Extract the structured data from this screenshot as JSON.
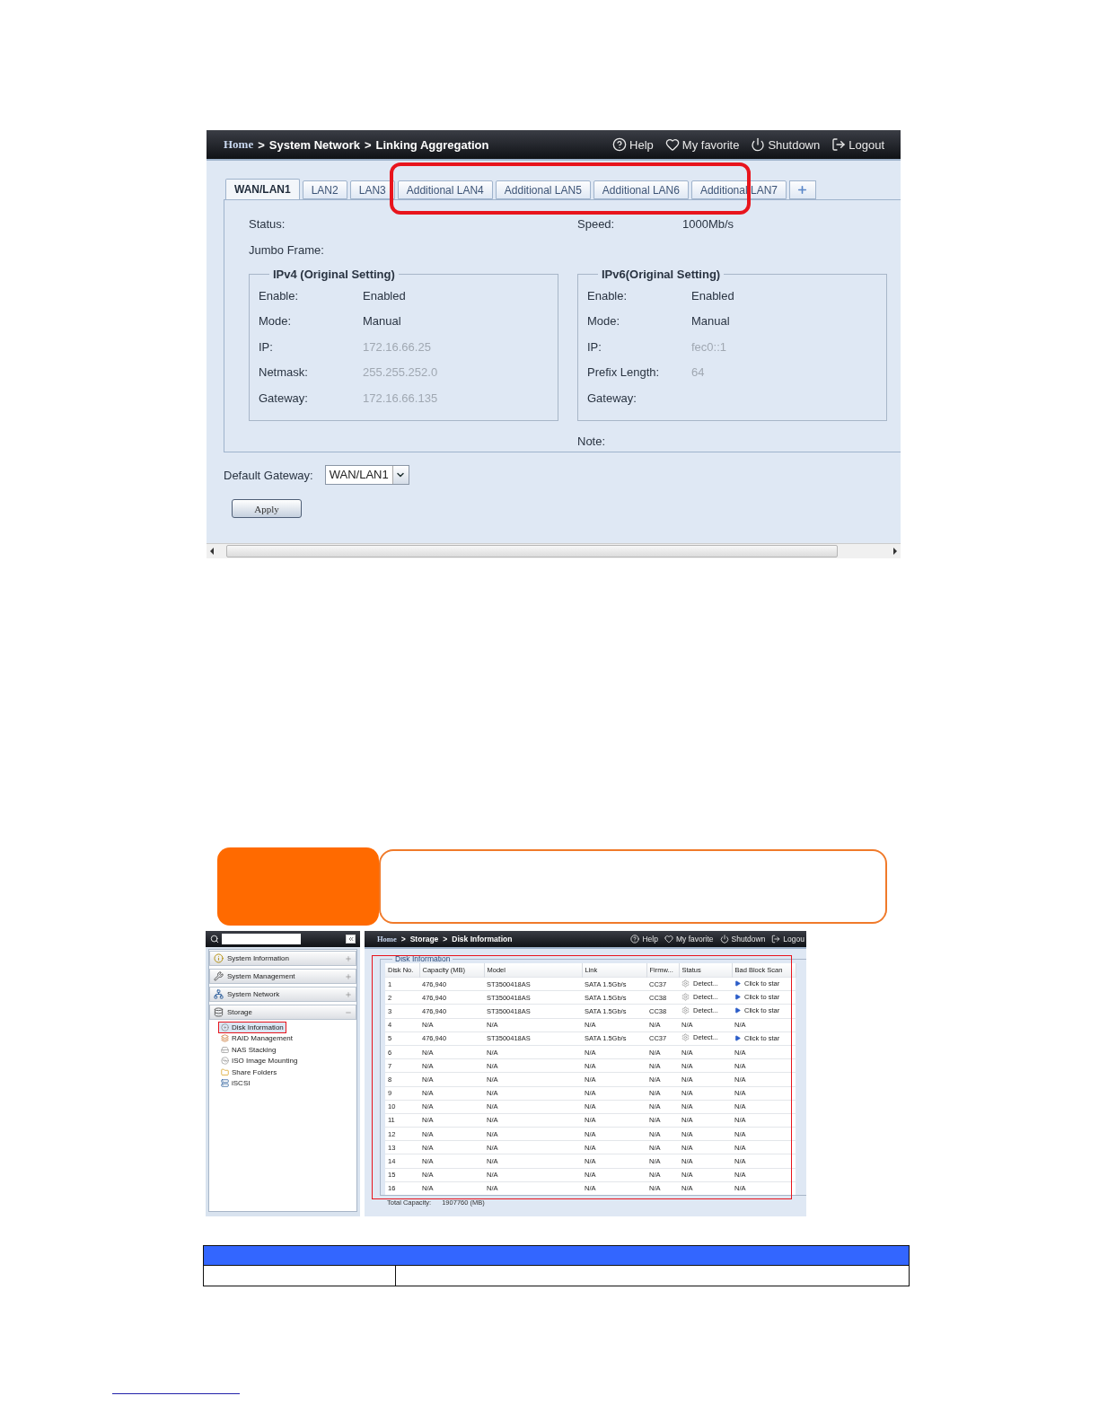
{
  "network_window": {
    "breadcrumb": [
      "Home",
      "System Network",
      "Linking Aggregation"
    ],
    "separator": ">",
    "toolbar": [
      {
        "label": "Help",
        "kind": "help"
      },
      {
        "label": "My favorite",
        "kind": "favorite"
      },
      {
        "label": "Shutdown",
        "kind": "shutdown"
      },
      {
        "label": "Logout",
        "kind": "logout"
      }
    ],
    "tabs": [
      {
        "label": "WAN/LAN1",
        "selected": true
      },
      {
        "label": "LAN2",
        "selected": false
      },
      {
        "label": "LAN3",
        "selected": false
      },
      {
        "label": "Additional LAN4",
        "selected": false
      },
      {
        "label": "Additional LAN5",
        "selected": false
      },
      {
        "label": "Additional LAN6",
        "selected": false
      },
      {
        "label": "Additional LAN7",
        "selected": false
      }
    ],
    "status_label": "Status:",
    "speed_label": "Speed:",
    "speed_value": "1000Mb/s",
    "jumbo_label": "Jumbo Frame:",
    "ipv4": {
      "title": "IPv4 (Original Setting)",
      "fields": [
        {
          "label": "Enable:",
          "value": "Enabled",
          "greyed": false
        },
        {
          "label": "Mode:",
          "value": "Manual",
          "greyed": false
        },
        {
          "label": "IP:",
          "value": "172.16.66.25",
          "greyed": true
        },
        {
          "label": "Netmask:",
          "value": "255.255.252.0",
          "greyed": true
        },
        {
          "label": "Gateway:",
          "value": "172.16.66.135",
          "greyed": true
        }
      ]
    },
    "ipv6": {
      "title": "IPv6(Original Setting)",
      "fields": [
        {
          "label": "Enable:",
          "value": "Enabled",
          "greyed": false
        },
        {
          "label": "Mode:",
          "value": "Manual",
          "greyed": false
        },
        {
          "label": "IP:",
          "value": "fec0::1",
          "greyed": true
        },
        {
          "label": "Prefix Length:",
          "value": "64",
          "greyed": true
        },
        {
          "label": "Gateway:"
        }
      ]
    },
    "note_label": "Note:",
    "default_gateway": {
      "label": "Default Gateway:",
      "value": "WAN/LAN1"
    },
    "apply": "Apply"
  },
  "disk_window": {
    "sidebar": [
      {
        "label": "System Information",
        "kind": "info",
        "expanded": false
      },
      {
        "label": "System Management",
        "kind": "tools",
        "expanded": false
      },
      {
        "label": "System Network",
        "kind": "network",
        "expanded": false
      },
      {
        "label": "Storage",
        "kind": "storage",
        "expanded": true,
        "children": [
          {
            "label": "Disk Information",
            "kind": "disk",
            "selected": true
          },
          {
            "label": "RAID Management",
            "kind": "raid",
            "selected": false
          },
          {
            "label": "NAS Stacking",
            "kind": "stack",
            "selected": false
          },
          {
            "label": "ISO Image Mounting",
            "kind": "iso",
            "selected": false
          },
          {
            "label": "Share Folders",
            "kind": "folder",
            "selected": false
          },
          {
            "label": "iSCSI",
            "kind": "iscsi",
            "selected": false
          }
        ]
      }
    ],
    "breadcrumb": [
      "Home",
      "Storage",
      "Disk Information"
    ],
    "separator": ">",
    "toolbar": [
      {
        "label": "Help",
        "kind": "help"
      },
      {
        "label": "My favorite",
        "kind": "favorite"
      },
      {
        "label": "Shutdown",
        "kind": "shutdown"
      },
      {
        "label": "Logou",
        "kind": "logout"
      }
    ],
    "section_title": "Disk Information",
    "columns": [
      "Disk No.",
      "Capacity (MB)",
      "Model",
      "Link",
      "Firmw...",
      "Status",
      "Bad Block Scan"
    ],
    "rows": [
      {
        "kind": "disk",
        "cells": [
          "1",
          "476,940",
          "ST3500418AS",
          "SATA 1.5Gb/s",
          "CC37",
          "Detect...",
          "Click to star"
        ]
      },
      {
        "kind": "disk",
        "cells": [
          "2",
          "476,940",
          "ST3500418AS",
          "SATA 1.5Gb/s",
          "CC38",
          "Detect...",
          "Click to star"
        ]
      },
      {
        "kind": "disk",
        "cells": [
          "3",
          "476,940",
          "ST3500418AS",
          "SATA 1.5Gb/s",
          "CC38",
          "Detect...",
          "Click to star"
        ]
      },
      {
        "kind": "empty",
        "cells": [
          "4",
          "N/A",
          "N/A",
          "N/A",
          "N/A",
          "N/A",
          "N/A"
        ]
      },
      {
        "kind": "disk",
        "cells": [
          "5",
          "476,940",
          "ST3500418AS",
          "SATA 1.5Gb/s",
          "CC37",
          "Detect...",
          "Click to star"
        ]
      },
      {
        "kind": "empty",
        "cells": [
          "6",
          "N/A",
          "N/A",
          "N/A",
          "N/A",
          "N/A",
          "N/A"
        ]
      },
      {
        "kind": "empty",
        "cells": [
          "7",
          "N/A",
          "N/A",
          "N/A",
          "N/A",
          "N/A",
          "N/A"
        ]
      },
      {
        "kind": "empty",
        "cells": [
          "8",
          "N/A",
          "N/A",
          "N/A",
          "N/A",
          "N/A",
          "N/A"
        ]
      },
      {
        "kind": "empty",
        "cells": [
          "9",
          "N/A",
          "N/A",
          "N/A",
          "N/A",
          "N/A",
          "N/A"
        ]
      },
      {
        "kind": "empty",
        "cells": [
          "10",
          "N/A",
          "N/A",
          "N/A",
          "N/A",
          "N/A",
          "N/A"
        ]
      },
      {
        "kind": "empty",
        "cells": [
          "11",
          "N/A",
          "N/A",
          "N/A",
          "N/A",
          "N/A",
          "N/A"
        ]
      },
      {
        "kind": "empty",
        "cells": [
          "12",
          "N/A",
          "N/A",
          "N/A",
          "N/A",
          "N/A",
          "N/A"
        ]
      },
      {
        "kind": "empty",
        "cells": [
          "13",
          "N/A",
          "N/A",
          "N/A",
          "N/A",
          "N/A",
          "N/A"
        ]
      },
      {
        "kind": "empty",
        "cells": [
          "14",
          "N/A",
          "N/A",
          "N/A",
          "N/A",
          "N/A",
          "N/A"
        ]
      },
      {
        "kind": "empty",
        "cells": [
          "15",
          "N/A",
          "N/A",
          "N/A",
          "N/A",
          "N/A",
          "N/A"
        ]
      },
      {
        "kind": "empty",
        "cells": [
          "16",
          "N/A",
          "N/A",
          "N/A",
          "N/A",
          "N/A",
          "N/A"
        ]
      }
    ],
    "total_label": "Total Capacity:",
    "total_value": "1907760 (MB)"
  }
}
